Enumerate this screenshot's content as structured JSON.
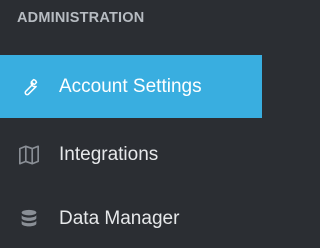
{
  "sidebar": {
    "section_title": "ADMINISTRATION",
    "items": [
      {
        "label": "Account Settings",
        "icon": "wrench-icon",
        "active": true
      },
      {
        "label": "Integrations",
        "icon": "map-icon",
        "active": false
      },
      {
        "label": "Data Manager",
        "icon": "database-icon",
        "active": false
      }
    ]
  },
  "colors": {
    "background": "#2b2e33",
    "active_background": "#39aee0",
    "header_text": "#b7bcc2",
    "item_text": "#e6e8ea",
    "icon_muted": "#8a8f96"
  }
}
